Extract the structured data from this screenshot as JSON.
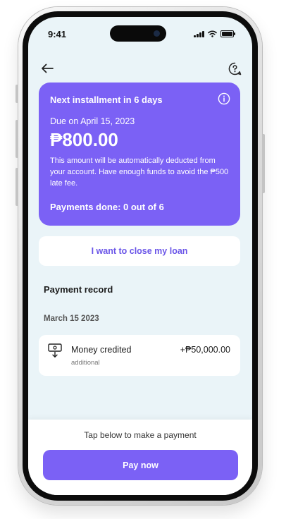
{
  "status_bar": {
    "time": "9:41"
  },
  "header": {
    "back_icon": "back-arrow-icon",
    "help_icon": "help-icon"
  },
  "installment_card": {
    "heading": "Next installment in 6 days",
    "info_icon": "info-icon",
    "due": "Due on April 15, 2023",
    "amount": "₱800.00",
    "note": "This amount will be automatically deducted from your account. Have enough funds to avoid the ₱500 late fee.",
    "payments_done": "Payments done: 0 out of 6",
    "color": "#7b61f5"
  },
  "close_loan_label": "I want to close my loan",
  "payment_record": {
    "title": "Payment record",
    "groups": [
      {
        "date": "March 15 2023",
        "items": [
          {
            "icon": "money-transfer-icon",
            "title": "Money credited",
            "subtitle": "additional",
            "amount": "+₱50,000.00"
          }
        ]
      }
    ]
  },
  "bottom": {
    "prompt": "Tap below to make a payment",
    "pay_label": "Pay now"
  }
}
